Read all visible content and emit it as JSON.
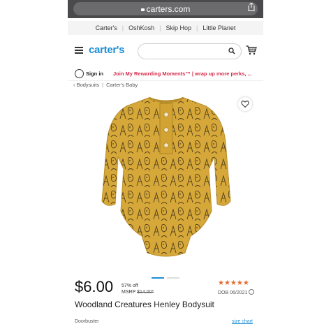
{
  "browser": {
    "url": "carters.com"
  },
  "brands": [
    "Carter's",
    "OshKosh",
    "Skip Hop",
    "Little Planet"
  ],
  "header": {
    "logo": "carter's",
    "search_placeholder": ""
  },
  "promo": {
    "signin": "Sign in",
    "text": "Join My Rewarding Moments™ | wrap up more perks, ..."
  },
  "breadcrumb": {
    "back": "‹ Bodysuits",
    "current": "Carter's Baby"
  },
  "product": {
    "price": "$6.00",
    "discount": "57% off",
    "msrp_label": "MSRP",
    "msrp_value": "$14.00*",
    "stars": "★★★★★",
    "dob": "DOB 06/2021",
    "name": "Woodland Creatures Henley Bodysuit",
    "tag": "Doorbuster",
    "size_chart": "size chart"
  },
  "carousel": {
    "total": 2,
    "active": 1
  },
  "colors": {
    "accent": "#1d8fd6",
    "promo": "#d62b4b",
    "stars": "#e66d2d",
    "garment": "#d6a83a"
  }
}
